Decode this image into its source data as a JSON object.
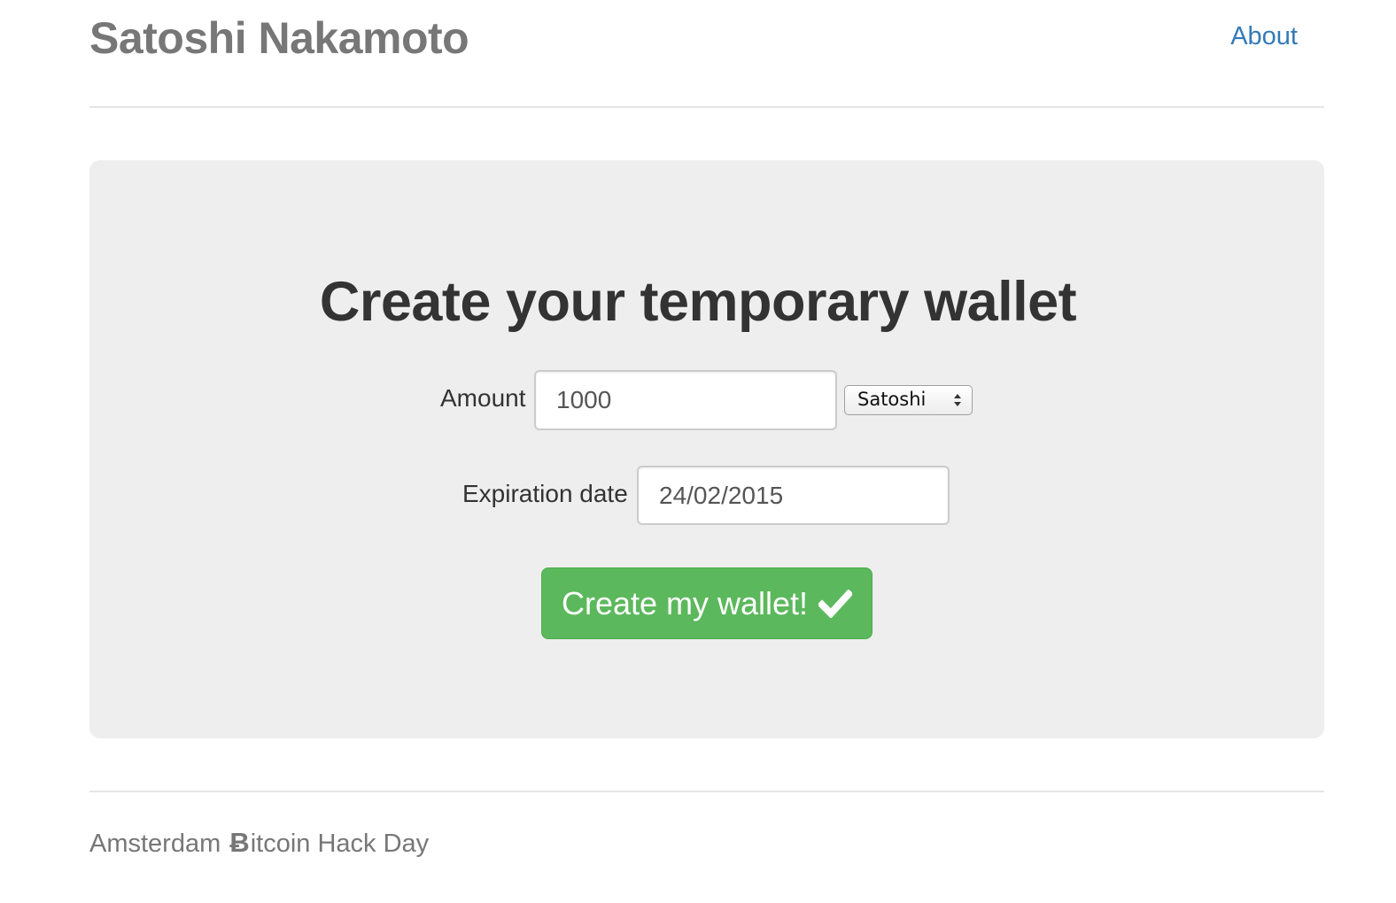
{
  "header": {
    "brand": "Satoshi Nakamoto",
    "about_link": "About"
  },
  "main": {
    "title": "Create your temporary wallet",
    "amount": {
      "label": "Amount",
      "value": "1000"
    },
    "unit_select": {
      "selected": "Satoshi"
    },
    "expiration": {
      "label": "Expiration date",
      "value": "24/02/2015"
    },
    "submit_label": "Create my wallet!"
  },
  "footer": {
    "prefix": "Amsterdam",
    "bitcoin_symbol": "Ƀ",
    "suffix": "itcoin Hack Day"
  },
  "colors": {
    "brand_text": "#777777",
    "link": "#337ab7",
    "jumbotron_bg": "#eeeeee",
    "button_success": "#5cb85c"
  },
  "icons": {
    "submit": "check-icon",
    "select": "select-arrows-icon",
    "footer": "bitcoin-icon"
  }
}
